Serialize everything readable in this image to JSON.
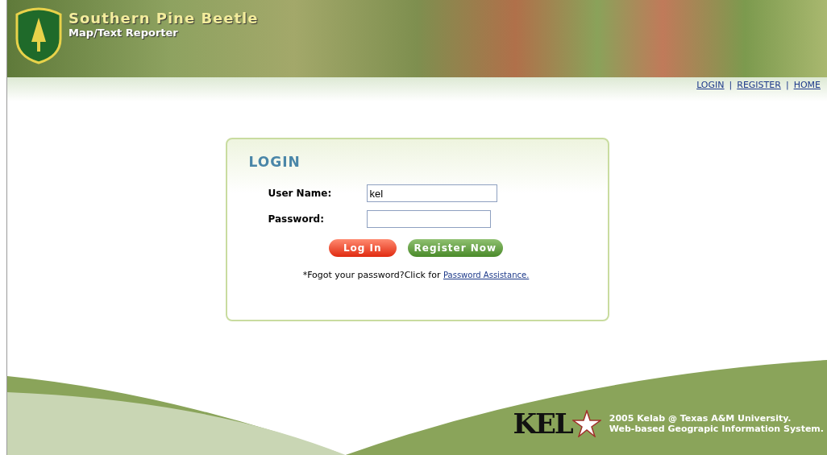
{
  "header": {
    "title": "Southern Pine Beetle",
    "subtitle": "Map/Text Reporter"
  },
  "nav": [
    {
      "label": "LOGIN"
    },
    {
      "label": "REGISTER",
      "separator": "|"
    },
    {
      "label": "HOME",
      "separator": "|"
    }
  ],
  "login": {
    "heading": "LOGIN",
    "fields": [
      {
        "label": "User Name:",
        "value": "kel",
        "kind": "text"
      },
      {
        "label": "Password:",
        "kind": "password"
      }
    ],
    "buttons": [
      {
        "label": "Log In",
        "kind": "primary"
      },
      {
        "label": "Register Now",
        "kind": "secondary"
      }
    ],
    "help_text": "*Fogot your password?Click for",
    "help_link": "Password Assistance."
  },
  "footer": {
    "logo": "KEL",
    "lines": [
      "2005 Kelab @ Texas A&M University.",
      "Web-based Geograpic Information System."
    ]
  }
}
